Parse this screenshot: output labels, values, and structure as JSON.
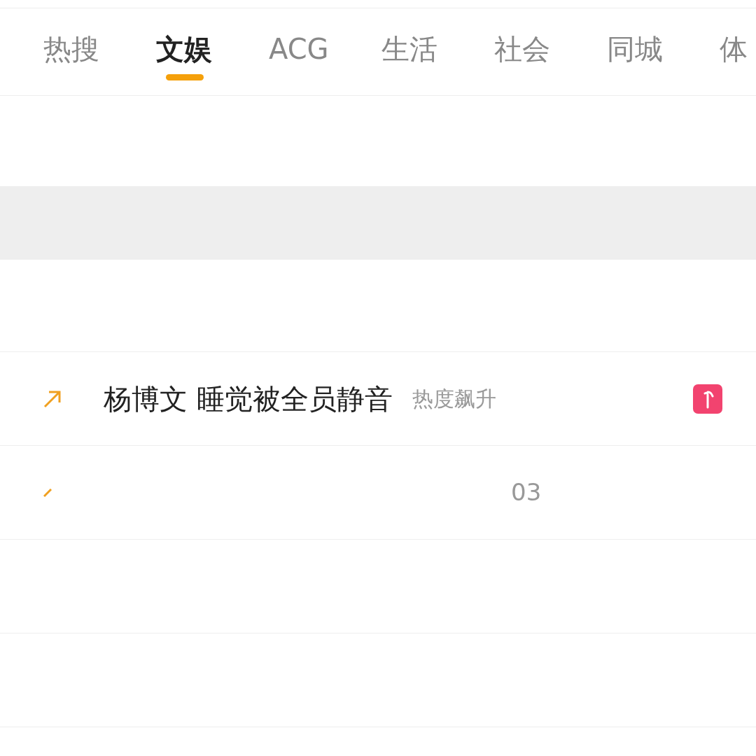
{
  "tabs": [
    {
      "label": "热搜",
      "selected": false
    },
    {
      "label": "文娱",
      "selected": true
    },
    {
      "label": "ACG",
      "selected": false
    },
    {
      "label": "生活",
      "selected": false
    },
    {
      "label": "社会",
      "selected": false
    },
    {
      "label": "同城",
      "selected": false
    },
    {
      "label": "体",
      "selected": false
    }
  ],
  "rows": [
    {
      "kind": "full",
      "title": "杨博文 睡觉被全员静音",
      "tag": "热度飙升"
    },
    {
      "kind": "partial",
      "value": "03"
    }
  ]
}
